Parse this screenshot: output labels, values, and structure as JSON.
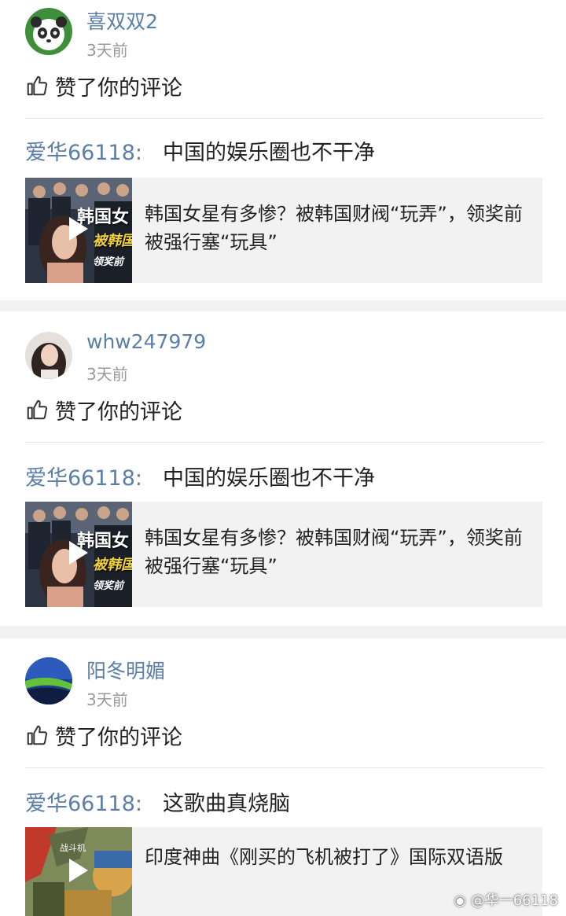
{
  "feed": [
    {
      "user": "喜双双2",
      "time": "3天前",
      "action": "赞了你的评论",
      "commenter": "爱华66118:",
      "comment": "中国的娱乐圈也不干净",
      "link_title": "韩国女星有多惨？被韩国财阀“玩弄”，领奖前被强行塞“玩具”",
      "thumb_text_1": "韩国女",
      "thumb_text_2": "被韩国",
      "thumb_text_3": "领奖前"
    },
    {
      "user": "whw247979",
      "time": "3天前",
      "action": "赞了你的评论",
      "commenter": "爱华66118:",
      "comment": "中国的娱乐圈也不干净",
      "link_title": "韩国女星有多惨？被韩国财阀“玩弄”，领奖前被强行塞“玩具”",
      "thumb_text_1": "韩国女",
      "thumb_text_2": "被韩国",
      "thumb_text_3": "领奖前"
    },
    {
      "user": "阳冬明媚",
      "time": "3天前",
      "action": "赞了你的评论",
      "commenter": "爱华66118:",
      "comment": "这歌曲真烧脑",
      "link_title": "印度神曲《刚买的飞机被打了》国际双语版",
      "thumb_text_1": "战斗机"
    }
  ],
  "watermark": "@华一66118",
  "icons": {
    "like": "thumbs-up-icon",
    "play": "play-icon",
    "weibo": "weibo-logo-icon"
  }
}
